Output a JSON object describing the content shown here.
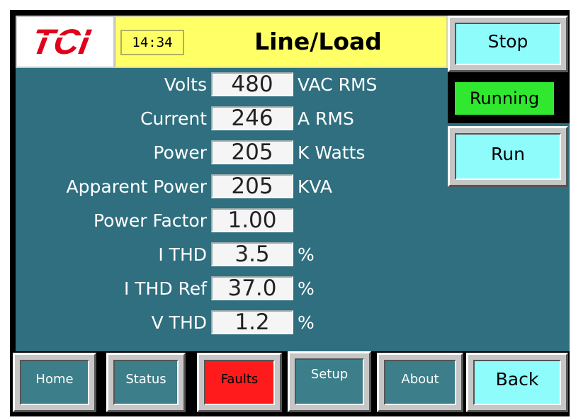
{
  "header": {
    "logo_text": "TCI",
    "clock": "14:34",
    "title": "Line/Load"
  },
  "controls": {
    "stop_label": "Stop",
    "status_label": "Running",
    "run_label": "Run"
  },
  "readings": [
    {
      "label": "Volts",
      "value": "480",
      "unit": "VAC RMS"
    },
    {
      "label": "Current",
      "value": "246",
      "unit": "A RMS"
    },
    {
      "label": "Power",
      "value": "205",
      "unit": "K Watts"
    },
    {
      "label": "Apparent Power",
      "value": "205",
      "unit": "KVA"
    },
    {
      "label": "Power Factor",
      "value": "1.00",
      "unit": ""
    },
    {
      "label": "I THD",
      "value": "3.5",
      "unit": "%"
    },
    {
      "label": "I THD Ref",
      "value": "37.0",
      "unit": "%"
    },
    {
      "label": "V THD",
      "value": "1.2",
      "unit": "%"
    }
  ],
  "nav": {
    "home": "Home",
    "status": "Status",
    "faults": "Faults",
    "setup": "Setup",
    "about": "About",
    "back": "Back"
  },
  "colors": {
    "header": "#ffff66",
    "panel": "#2f6f7f",
    "button_cyan": "#8ffcfc",
    "running": "#2fe82f",
    "faults": "#ff1b1b",
    "logo_red": "#e0001a"
  }
}
